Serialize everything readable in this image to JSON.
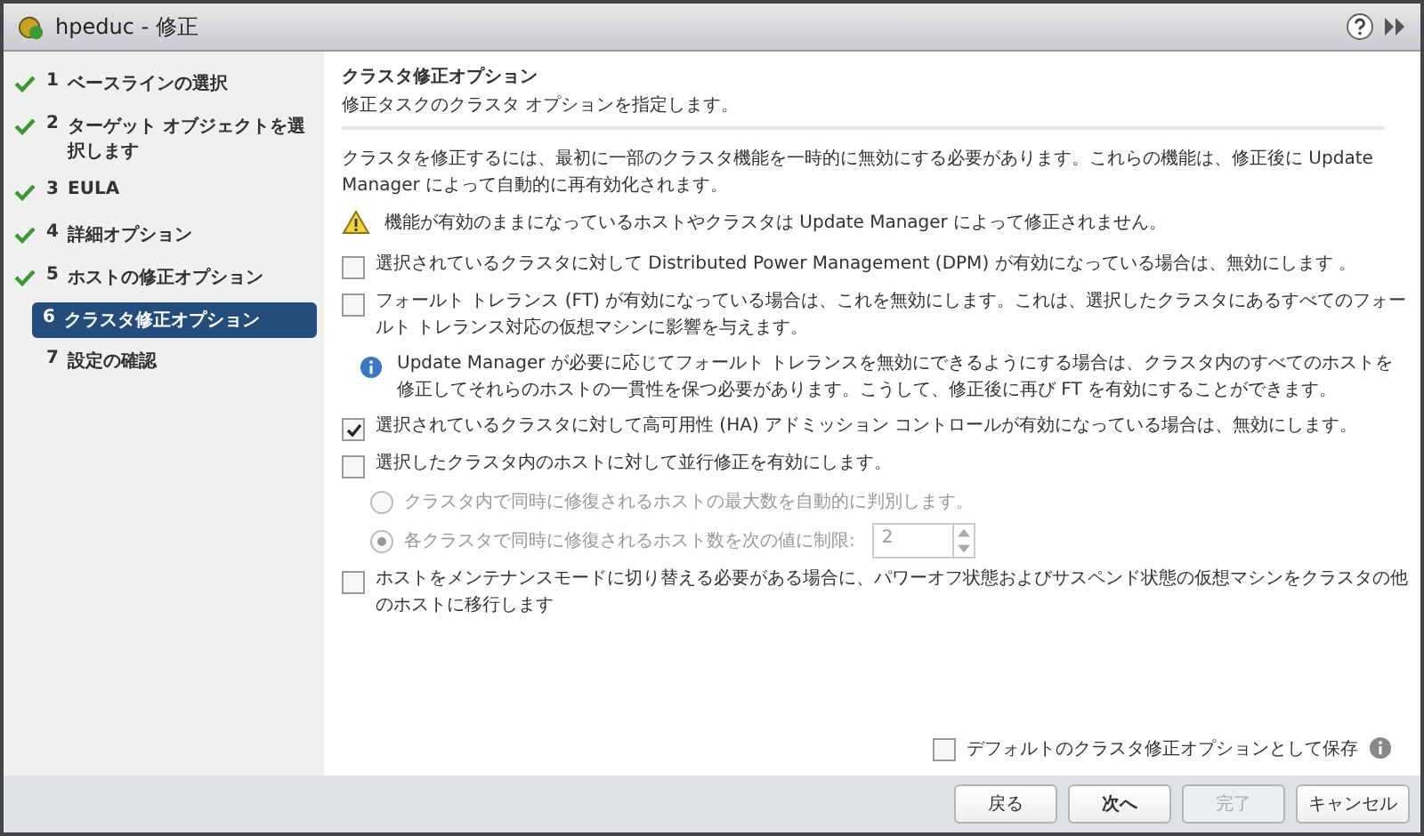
{
  "window": {
    "title": "hpeduc - 修正"
  },
  "steps": [
    {
      "number": "1",
      "label": "ベースラインの選択",
      "done": true,
      "selected": false
    },
    {
      "number": "2",
      "label": "ターゲット オブジェクトを選択します",
      "done": true,
      "selected": false
    },
    {
      "number": "3",
      "label": "EULA",
      "done": true,
      "selected": false
    },
    {
      "number": "4",
      "label": "詳細オプション",
      "done": true,
      "selected": false
    },
    {
      "number": "5",
      "label": "ホストの修正オプション",
      "done": true,
      "selected": false
    },
    {
      "number": "6",
      "label": "クラスタ修正オプション",
      "done": false,
      "selected": true
    },
    {
      "number": "7",
      "label": "設定の確認",
      "done": false,
      "selected": false
    }
  ],
  "header": {
    "title": "クラスタ修正オプション",
    "subtitle": "修正タスクのクラスタ オプションを指定します。"
  },
  "intro": "クラスタを修正するには、最初に一部のクラスタ機能を一時的に無効にする必要があります。これらの機能は、修正後に Update Manager によって自動的に再有効化されます。",
  "warning": "機能が有効のままになっているホストやクラスタは Update Manager によって修正されません。",
  "options": [
    {
      "kind": "checkbox",
      "label": "選択されているクラスタに対して Distributed Power Management (DPM) が有効になっている場合は、無効にします 。",
      "checked": false
    },
    {
      "kind": "checkbox",
      "label": "フォールト トレランス (FT) が有効になっている場合は、これを無効にします。これは、選択したクラスタにあるすべてのフォールト トレランス対応の仮想マシンに影響を与えます。",
      "checked": false
    },
    {
      "kind": "info",
      "label": "Update Manager が必要に応じてフォールト トレランスを無効にできるようにする場合は、クラスタ内のすべてのホストを修正してそれらのホストの一貫性を保つ必要があります。こうして、修正後に再び FT を有効にすることができます。"
    },
    {
      "kind": "checkbox",
      "label": "選択されているクラスタに対して高可用性 (HA) アドミッション コントロールが有効になっている場合は、無効にします。",
      "checked": true
    },
    {
      "kind": "checkbox",
      "label": "選択したクラスタ内のホストに対して並行修正を有効にします。",
      "checked": false
    },
    {
      "kind": "radio",
      "label": "クラスタ内で同時に修復されるホストの最大数を自動的に判別します。",
      "selected": false,
      "disabled": true
    },
    {
      "kind": "radio",
      "label": "各クラスタで同時に修復されるホスト数を次の値に制限:",
      "selected": true,
      "disabled": true,
      "value": "2"
    },
    {
      "kind": "checkbox",
      "label": "ホストをメンテナンスモードに切り替える必要がある場合に、パワーオフ状態およびサスペンド状態の仮想マシンをクラスタの他のホストに移行します",
      "checked": false
    }
  ],
  "save_default": {
    "label": "デフォルトのクラスタ修正オプションとして保存",
    "checked": false
  },
  "buttons": [
    {
      "label": "戻る",
      "disabled": false,
      "default": false
    },
    {
      "label": "次へ",
      "disabled": false,
      "default": true
    },
    {
      "label": "完了",
      "disabled": true,
      "default": false
    },
    {
      "label": "キャンセル",
      "disabled": false,
      "default": false
    }
  ]
}
